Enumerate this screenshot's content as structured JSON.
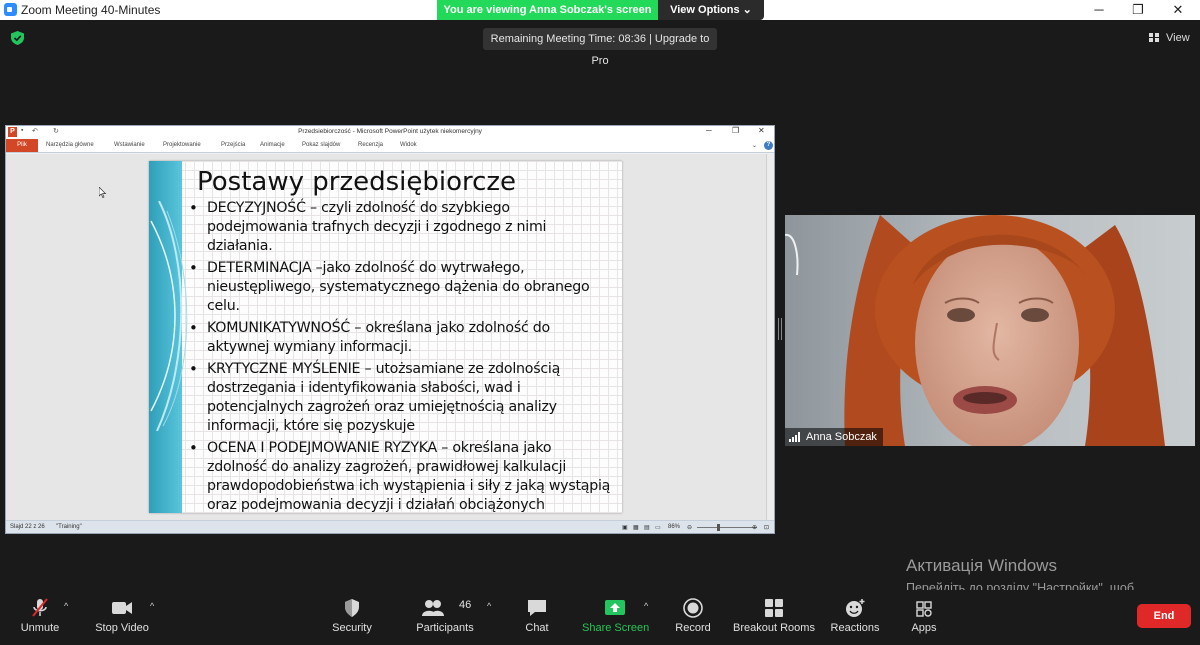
{
  "window": {
    "title": "Zoom Meeting 40-Minutes"
  },
  "banner": {
    "viewing": "You are viewing Anna Sobczak's screen",
    "view_options": "View Options"
  },
  "meeting": {
    "remaining": "Remaining Meeting Time: 08:36 | Upgrade to Pro",
    "view_label": "View"
  },
  "powerpoint": {
    "doc_title": "Przedsiebiorczość - Microsoft PowerPoint użytek niekomercyjny",
    "tabs": [
      "Plik",
      "Narzędzia główne",
      "Wstawianie",
      "Projektowanie",
      "Przejścia",
      "Animacje",
      "Pokaz slajdów",
      "Recenzja",
      "Widok"
    ],
    "status_slide": "Slajd 22 z 26",
    "status_theme": "\"Training\"",
    "zoom": "86%"
  },
  "slide": {
    "title": "Postawy przedsiębiorcze",
    "bullets": [
      "DECYZYJNOŚĆ – czyli zdolność do szybkiego podejmowania trafnych decyzji i zgodnego z nimi działania.",
      "DETERMINACJA –jako zdolność do wytrwałego, nieustępliwego, systematycznego dążenia do obranego celu.",
      "KOMUNIKATYWNOŚĆ – określana jako zdolność do aktywnej wymiany informacji.",
      "KRYTYCZNE MYŚLENIE – utożsamiane ze zdolnością dostrzegania i identyfikowania słabości, wad i potencjalnych zagrożeń oraz umiejętnością analizy informacji, które się pozyskuje",
      "OCENA I PODEJMOWANIE RYZYKA – określana jako zdolność do analizy zagrożeń, prawidłowej kalkulacji prawdopodobieństwa ich wystąpienia i siły z jaką wystąpią oraz podejmowania decyzji i działań obciążonych uzasadnionym ryzykiem niepowodzenia niższym niż szanse powodzenia lub kompensowanym skalą potencjalnej korzyści"
    ]
  },
  "participant": {
    "name": "Anna Sobczak"
  },
  "activation": {
    "title": "Активація Windows",
    "body": "Перейдіть до розділу \"Настройки\", щоб активувати Windows."
  },
  "toolbar": {
    "unmute": "Unmute",
    "stop_video": "Stop Video",
    "security": "Security",
    "participants": "Participants",
    "participants_count": "46",
    "chat": "Chat",
    "share_screen": "Share Screen",
    "record": "Record",
    "breakout": "Breakout Rooms",
    "reactions": "Reactions",
    "apps": "Apps",
    "end": "End"
  },
  "colors": {
    "share_green": "#23d959",
    "end_red": "#e02828",
    "ppt_orange": "#d24726"
  }
}
